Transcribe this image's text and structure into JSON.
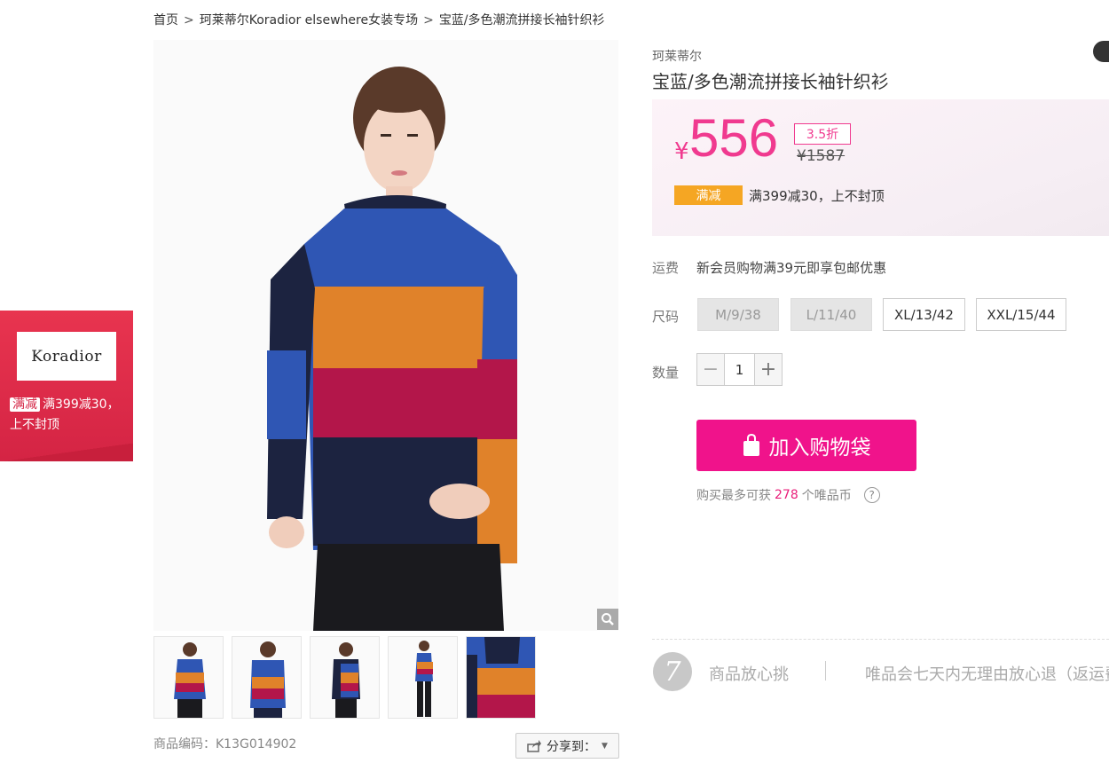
{
  "breadcrumb": {
    "home": "首页",
    "separator": ">",
    "store": "珂莱蒂尔Koradior elsewhere女装专场",
    "current": "宝蓝/多色潮流拼接长袖针织衫"
  },
  "product": {
    "brand": "珂莱蒂尔",
    "title": "宝蓝/多色潮流拼接长袖针织衫",
    "currency": "¥",
    "price": "556",
    "discount": "3.5折",
    "original_price": "¥1587",
    "promo_tag": "满减",
    "promo_text": "满399减30，上不封顶",
    "sku_code": "商品编码：K13G014902",
    "share_label": "分享到：",
    "sweater_colors": [
      "#2f56b4",
      "#e0822a",
      "#b3164a",
      "#1c2340"
    ]
  },
  "shipping": {
    "label": "运费",
    "text": "新会员购物满39元即享包邮优惠"
  },
  "size": {
    "label": "尺码",
    "options": [
      {
        "label": "M/9/38",
        "available": false
      },
      {
        "label": "L/11/40",
        "available": false
      },
      {
        "label": "XL/13/42",
        "available": true
      },
      {
        "label": "XXL/15/44",
        "available": true
      }
    ]
  },
  "quantity": {
    "label": "数量",
    "value": "1",
    "minus": "−",
    "plus": "+"
  },
  "cart": {
    "button_label": "加入购物袋",
    "coin_prefix": "购买最多可获",
    "coin_count": "278",
    "coin_suffix": "个唯品币",
    "help": "?"
  },
  "brand_float": {
    "logo_text": "Koradior",
    "tag": "满减",
    "promo": "满399减30，上不封顶"
  },
  "assurance": {
    "icon": "7",
    "title": "商品放心挑",
    "text": "唯品会七天内无理由放心退（返运费"
  },
  "colors": {
    "accent": "#f0138b",
    "price": "#f03a8f",
    "promo": "#f5a623",
    "brand_red": "#e8344f"
  }
}
